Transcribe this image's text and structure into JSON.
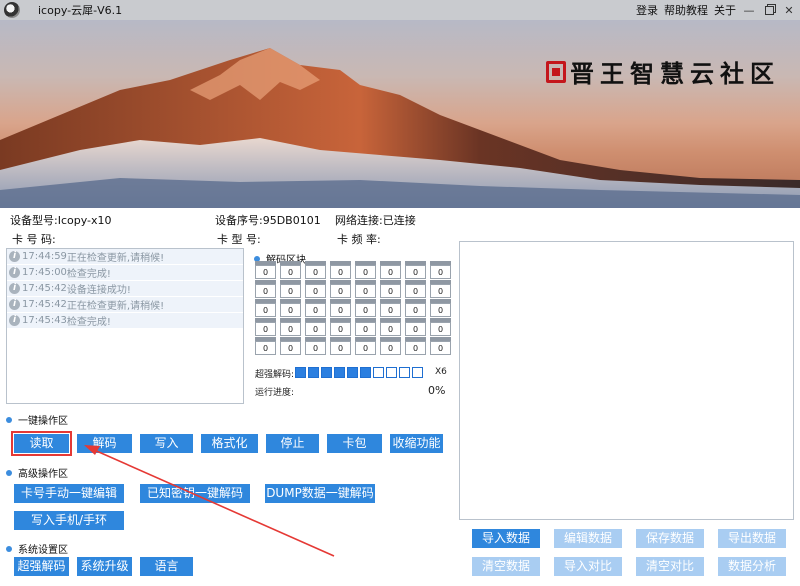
{
  "window": {
    "title": "icopy-云犀-V6.1",
    "links": [
      "登录",
      "帮助教程",
      "关于"
    ],
    "controls": {
      "minimize": "—"
    }
  },
  "banner": {
    "brand_text": "晋王智慧云社区"
  },
  "device": {
    "model": "设备型号:Icopy-x10",
    "serial": "设备序号:95DB0101",
    "network": "网络连接:已连接",
    "card_no": "卡 号 码:",
    "card_type": "卡 型 号:",
    "card_freq": "卡 频 率:"
  },
  "log": [
    {
      "time": "17:44:59",
      "text": "正在检查更新,请稍候!"
    },
    {
      "time": "17:45:00",
      "text": "检查完成!"
    },
    {
      "time": "17:45:42",
      "text": "设备连接成功!"
    },
    {
      "time": "17:45:42",
      "text": "正在检查更新,请稍候!"
    },
    {
      "time": "17:45:43",
      "text": "检查完成!"
    }
  ],
  "decode": {
    "section_title": "解码区块",
    "cell_value": "0",
    "boost_label": "超强解码:",
    "boost_on": 6,
    "boost_total": 10,
    "boost_multiplier": "X6",
    "progress_label": "运行进度:",
    "progress_text": "0%",
    "progress_fraction": 0
  },
  "sections": {
    "one_key": "一键操作区",
    "advanced": "高级操作区",
    "system": "系统设置区"
  },
  "one_key_buttons": [
    "读取",
    "解码",
    "写入",
    "格式化",
    "停止",
    "卡包",
    "收缩功能"
  ],
  "advanced_buttons": [
    "卡号手动一键编辑",
    "已知密钥一键解码",
    "DUMP数据一键解码",
    "写入手机/手环"
  ],
  "system_buttons": [
    "超强解码",
    "系统升级",
    "语言"
  ],
  "data_buttons": [
    "导入数据",
    "编辑数据",
    "保存数据",
    "导出数据",
    "清空数据",
    "导入对比",
    "清空对比",
    "数据分析"
  ],
  "colors": {
    "accent": "#2f87dd",
    "accent_light": "#a9cdf2",
    "highlight": "#e53935"
  }
}
